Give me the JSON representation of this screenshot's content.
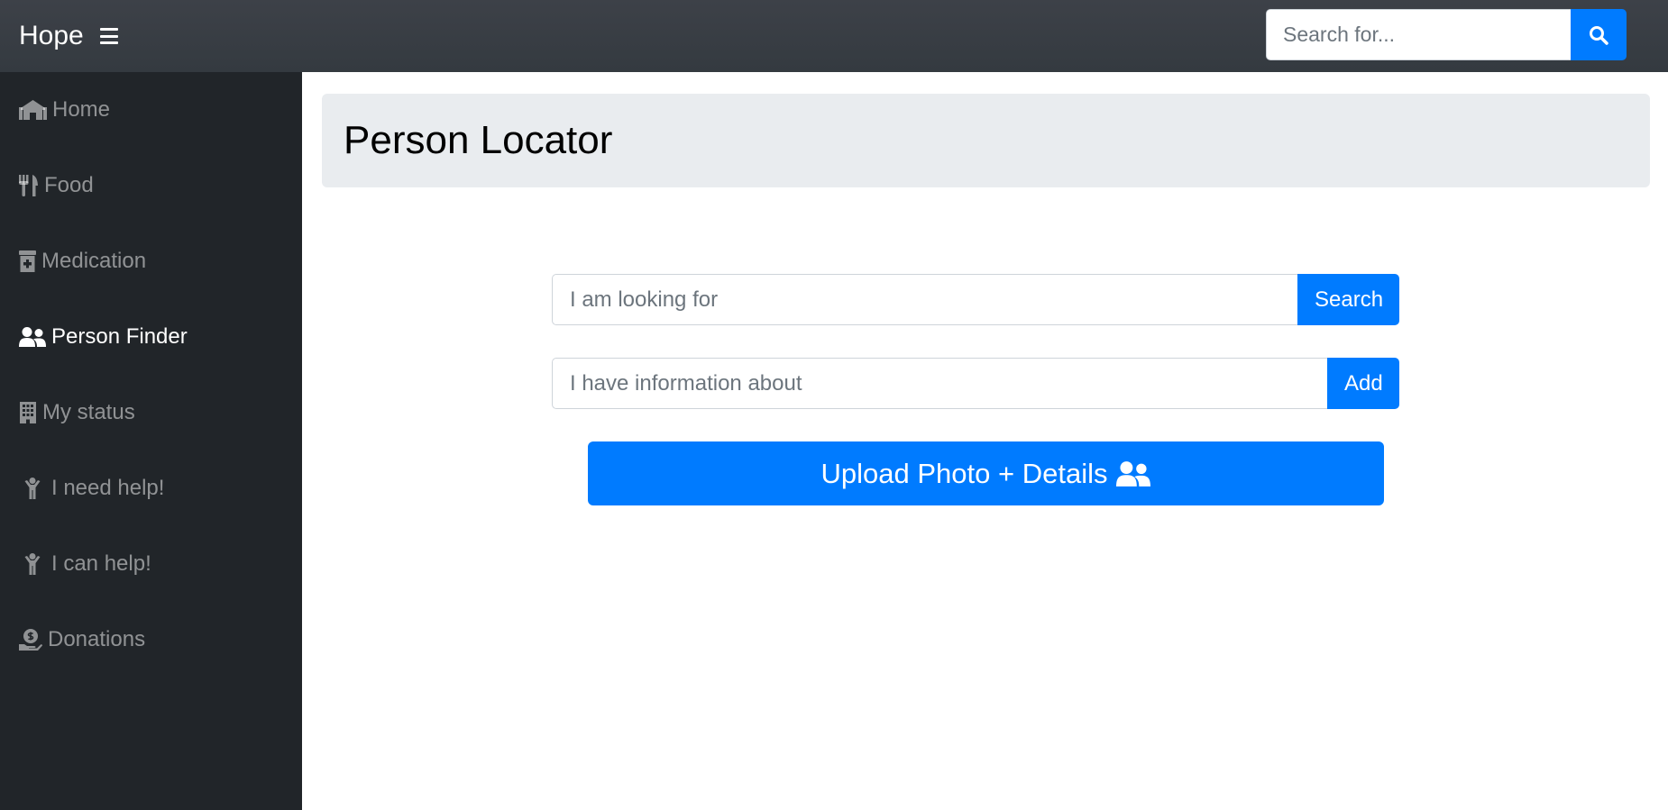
{
  "header": {
    "brand": "Hope",
    "menu_icon": "hamburger-icon",
    "search": {
      "placeholder": "Search for...",
      "value": "",
      "button_icon": "search-icon"
    }
  },
  "sidebar": {
    "items": [
      {
        "label": "Home",
        "icon": "home-icon",
        "active": false
      },
      {
        "label": "Food",
        "icon": "utensils-icon",
        "active": false
      },
      {
        "label": "Medication",
        "icon": "prescription-bottle-icon",
        "active": false
      },
      {
        "label": "Person Finder",
        "icon": "user-friends-icon",
        "active": true
      },
      {
        "label": "My status",
        "icon": "building-icon",
        "active": false
      },
      {
        "label": "I need help!",
        "icon": "child-icon",
        "active": false
      },
      {
        "label": "I can help!",
        "icon": "child-icon",
        "active": false
      },
      {
        "label": "Donations",
        "icon": "hand-holding-usd-icon",
        "active": false
      }
    ]
  },
  "main": {
    "title": "Person Locator",
    "looking_for": {
      "placeholder": "I am looking for",
      "value": "",
      "button_label": "Search"
    },
    "info_about": {
      "placeholder": "I have information about",
      "value": "",
      "button_label": "Add"
    },
    "upload_label": "Upload Photo + Details",
    "upload_icon": "user-friends-icon"
  },
  "colors": {
    "primary": "#007bff",
    "topbar": "#343a40",
    "sidebar": "#212529",
    "jumbotron": "#e9ecef"
  }
}
